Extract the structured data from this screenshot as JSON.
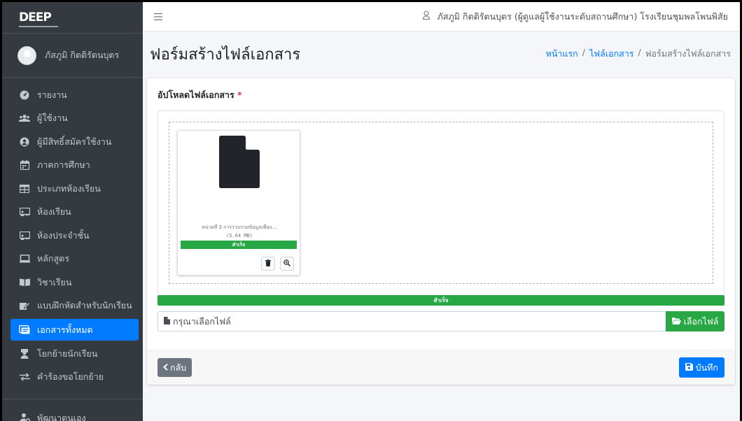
{
  "brand": {
    "logo_text": "DEEP"
  },
  "user_panel": {
    "name": "ภัสภูมิ กิตติรัตนบุตร"
  },
  "sidebar": {
    "items": [
      {
        "label": "รายงาน",
        "icon": "dashboard-icon"
      },
      {
        "label": "ผู้ใช้งาน",
        "icon": "users-icon"
      },
      {
        "label": "ผู้มีสิทธิ์สมัครใช้งาน",
        "icon": "user-circle-icon"
      },
      {
        "label": "ภาคการศึกษา",
        "icon": "calendar-icon"
      },
      {
        "label": "ประเภทห้องเรียน",
        "icon": "table-icon"
      },
      {
        "label": "ห้องเรียน",
        "icon": "chalkboard-icon"
      },
      {
        "label": "ห้องประจำชั้น",
        "icon": "chalkboard-teacher-icon"
      },
      {
        "label": "หลักสูตร",
        "icon": "laptop-icon"
      },
      {
        "label": "วิชาเรียน",
        "icon": "book-open-icon"
      },
      {
        "label": "แบบฝึกหัดสำหรับนักเรียน",
        "icon": "edit-icon"
      },
      {
        "label": "เอกสารทั้งหมด",
        "icon": "folder-open-icon",
        "active": true
      },
      {
        "label": "โยกย้ายนักเรียน",
        "icon": "student-icon"
      },
      {
        "label": "คำร้องขอโยกย้าย",
        "icon": "exchange-icon"
      }
    ],
    "bottom_item": {
      "label": "พัฒนาตนเอง",
      "icon": "user-cog-icon"
    }
  },
  "topbar": {
    "user_text": "ภัสภูมิ กิตติรัตนบุตร (ผู้ดูแลผู้ใช้งานระดับสถานศึกษา) โรงเรียนชุมพลโพนพิสัย"
  },
  "header": {
    "title": "ฟอร์มสร้างไฟล์เอกสาร",
    "breadcrumb": [
      "หน้าแรก",
      "ไฟล์เอกสาร",
      "ฟอร์มสร้างไฟล์เอกสาร"
    ],
    "separator": "/"
  },
  "form": {
    "upload_label": "อัปโหลดไฟล์เอกสาร",
    "required_mark": "*",
    "file": {
      "name": "หน่วยที่ 3 การรวบรวมข้อมูลเพื่อแ...",
      "size": "(5.64 MB)",
      "status": "สำเร็จ",
      "progress": 1.0
    },
    "overall_progress": {
      "label": "สำเร็จ",
      "value": 1.0
    },
    "file_input_placeholder": "กรุณาเลือกไฟล์",
    "choose_button": "เลือกไฟล์",
    "back_button": "กลับ",
    "save_button": "บันทึก"
  },
  "colors": {
    "sidebar_bg": "#343a40",
    "primary": "#007bff",
    "success": "#28a745",
    "secondary": "#6c757d"
  }
}
